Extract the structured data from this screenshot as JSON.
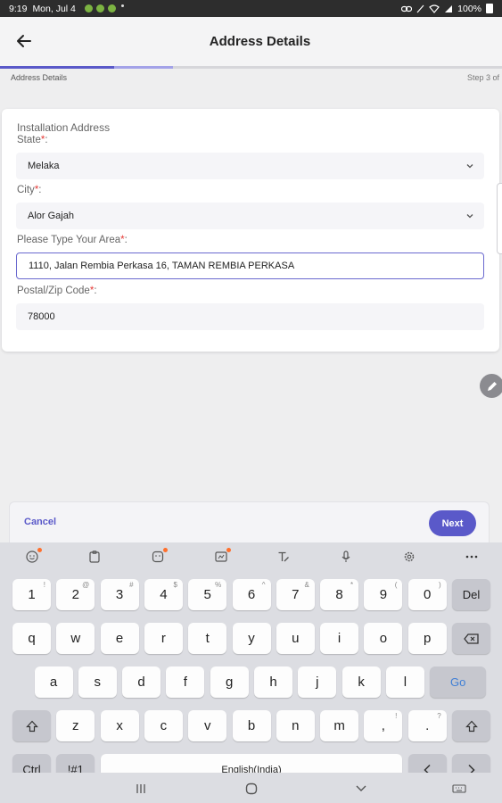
{
  "status_bar": {
    "time": "9:19",
    "date": "Mon, Jul 4",
    "battery": "100%"
  },
  "app_bar": {
    "title": "Address Details"
  },
  "progress": {
    "fraction": 0.345
  },
  "stepper": {
    "current_label": "Address Details",
    "step_text": "Step 3 of"
  },
  "form": {
    "section_title": "Installation Address",
    "state": {
      "label": "State",
      "value": "Melaka"
    },
    "city": {
      "label": "City",
      "value": "Alor Gajah"
    },
    "area": {
      "label": "Please Type Your Area",
      "value": "1110, Jalan Rembia Perkasa 16, TAMAN REMBIA PERKASA"
    },
    "postal": {
      "label": "Postal/Zip Code",
      "value": "78000"
    },
    "required_marker": "*",
    "label_suffix": ":"
  },
  "actions": {
    "cancel_label": "Cancel",
    "next_label": "Next"
  },
  "keyboard": {
    "row1": [
      {
        "k": "1",
        "s": "!"
      },
      {
        "k": "2",
        "s": "@"
      },
      {
        "k": "3",
        "s": "#"
      },
      {
        "k": "4",
        "s": "$"
      },
      {
        "k": "5",
        "s": "%"
      },
      {
        "k": "6",
        "s": "^"
      },
      {
        "k": "7",
        "s": "&"
      },
      {
        "k": "8",
        "s": "*"
      },
      {
        "k": "9",
        "s": "("
      },
      {
        "k": "0",
        "s": ")"
      }
    ],
    "del_label": "Del",
    "row2": [
      "q",
      "w",
      "e",
      "r",
      "t",
      "y",
      "u",
      "i",
      "o",
      "p"
    ],
    "row3": [
      "a",
      "s",
      "d",
      "f",
      "g",
      "h",
      "j",
      "k",
      "l"
    ],
    "go_label": "Go",
    "row4": [
      "z",
      "x",
      "c",
      "v",
      "b",
      "n",
      "m"
    ],
    "comma": {
      "k": ",",
      "s": "!"
    },
    "period": {
      "k": ".",
      "s": "?"
    },
    "ctrl_label": "Ctrl",
    "sym_label": "!#1",
    "space_label": "English(India)"
  },
  "colors": {
    "accent": "#5a59c9",
    "required": "#e53935",
    "status_dot": "#7cb342"
  }
}
